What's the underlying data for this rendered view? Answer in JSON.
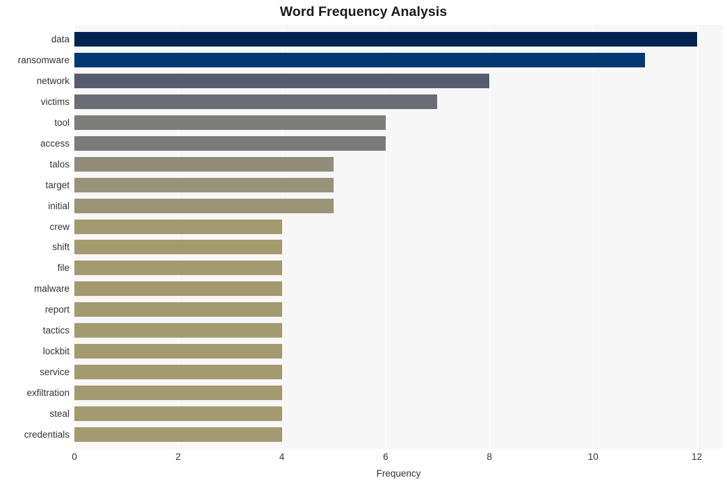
{
  "chart_data": {
    "type": "bar",
    "orientation": "horizontal",
    "title": "Word Frequency Analysis",
    "xlabel": "Frequency",
    "ylabel": "",
    "xlim": [
      0,
      12.5
    ],
    "xticks": [
      0,
      2,
      4,
      6,
      8,
      10,
      12
    ],
    "xtick_labels": [
      "0",
      "2",
      "4",
      "6",
      "8",
      "10",
      "12"
    ],
    "grid": true,
    "grid_axis": "x",
    "grid_color": "#ffffff",
    "plot_background": "#f7f7f7",
    "figure_background": "#ffffff",
    "legend": null,
    "categories": [
      "data",
      "ransomware",
      "network",
      "victims",
      "tool",
      "access",
      "talos",
      "target",
      "initial",
      "crew",
      "shift",
      "file",
      "malware",
      "report",
      "tactics",
      "lockbit",
      "service",
      "exfiltration",
      "steal",
      "credentials"
    ],
    "values": [
      12,
      11,
      8,
      7,
      6,
      6,
      5,
      5,
      5,
      4,
      4,
      4,
      4,
      4,
      4,
      4,
      4,
      4,
      4,
      4
    ],
    "bar_colors": [
      "#042350",
      "#043873",
      "#575c70",
      "#6c6c74",
      "#7d7d79",
      "#7b7b79",
      "#918d7a",
      "#98927a",
      "#9a9479",
      "#a39a72",
      "#a49a70",
      "#a49a70",
      "#a49a70",
      "#a49a70",
      "#a49a70",
      "#a49a70",
      "#a49a70",
      "#a49a70",
      "#a49a70",
      "#a49a70"
    ]
  }
}
